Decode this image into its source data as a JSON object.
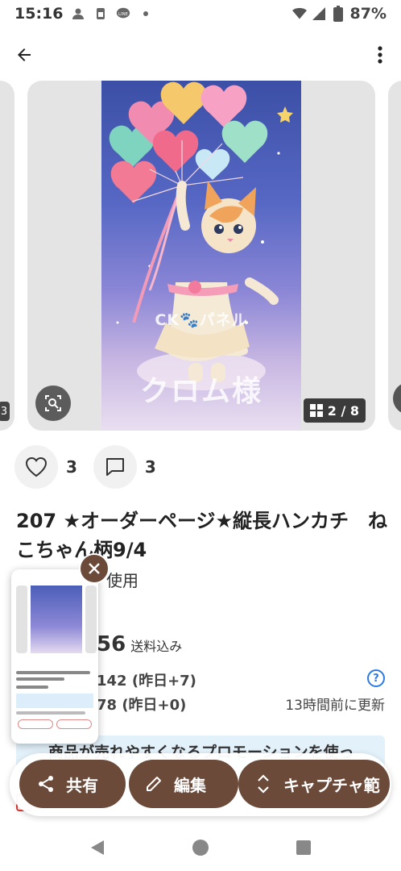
{
  "status_bar": {
    "time": "15:16",
    "battery": "87%",
    "icons": [
      "person-icon",
      "sim-icon",
      "line-app-icon",
      "dot-icon",
      "wifi-icon",
      "signal-icon",
      "battery-icon"
    ]
  },
  "app_bar": {
    "back_icon": "arrow-left-icon",
    "more_icon": "more-vertical-icon"
  },
  "carousel": {
    "watermark_mid": "CK🐾パネル",
    "watermark_big": "クロム様",
    "counter": "2 / 8",
    "lens_icon": "image-search-icon"
  },
  "reactions": {
    "likes": "3",
    "comments": "3"
  },
  "product": {
    "title": "207 ★オーダーページ★縦長ハンカチ　ねこちゃん柄9/4",
    "condition_partial": "使用",
    "price_partial": "56",
    "shipping": "送料込み",
    "views_partial": "142 (昨日+7)",
    "likes_partial": "78 (昨日+0)",
    "updated": "13時間前に更新",
    "help": "?"
  },
  "promo": {
    "text": "商品が売れやすくなるプロモーションを使っ"
  },
  "actions": {
    "share": "共有",
    "edit": "編集",
    "capture": "キャプチャ範"
  },
  "colors": {
    "accent_brown": "#6b4a3a",
    "help_blue": "#2c7be5",
    "promo_bg": "#e3f1fa"
  }
}
